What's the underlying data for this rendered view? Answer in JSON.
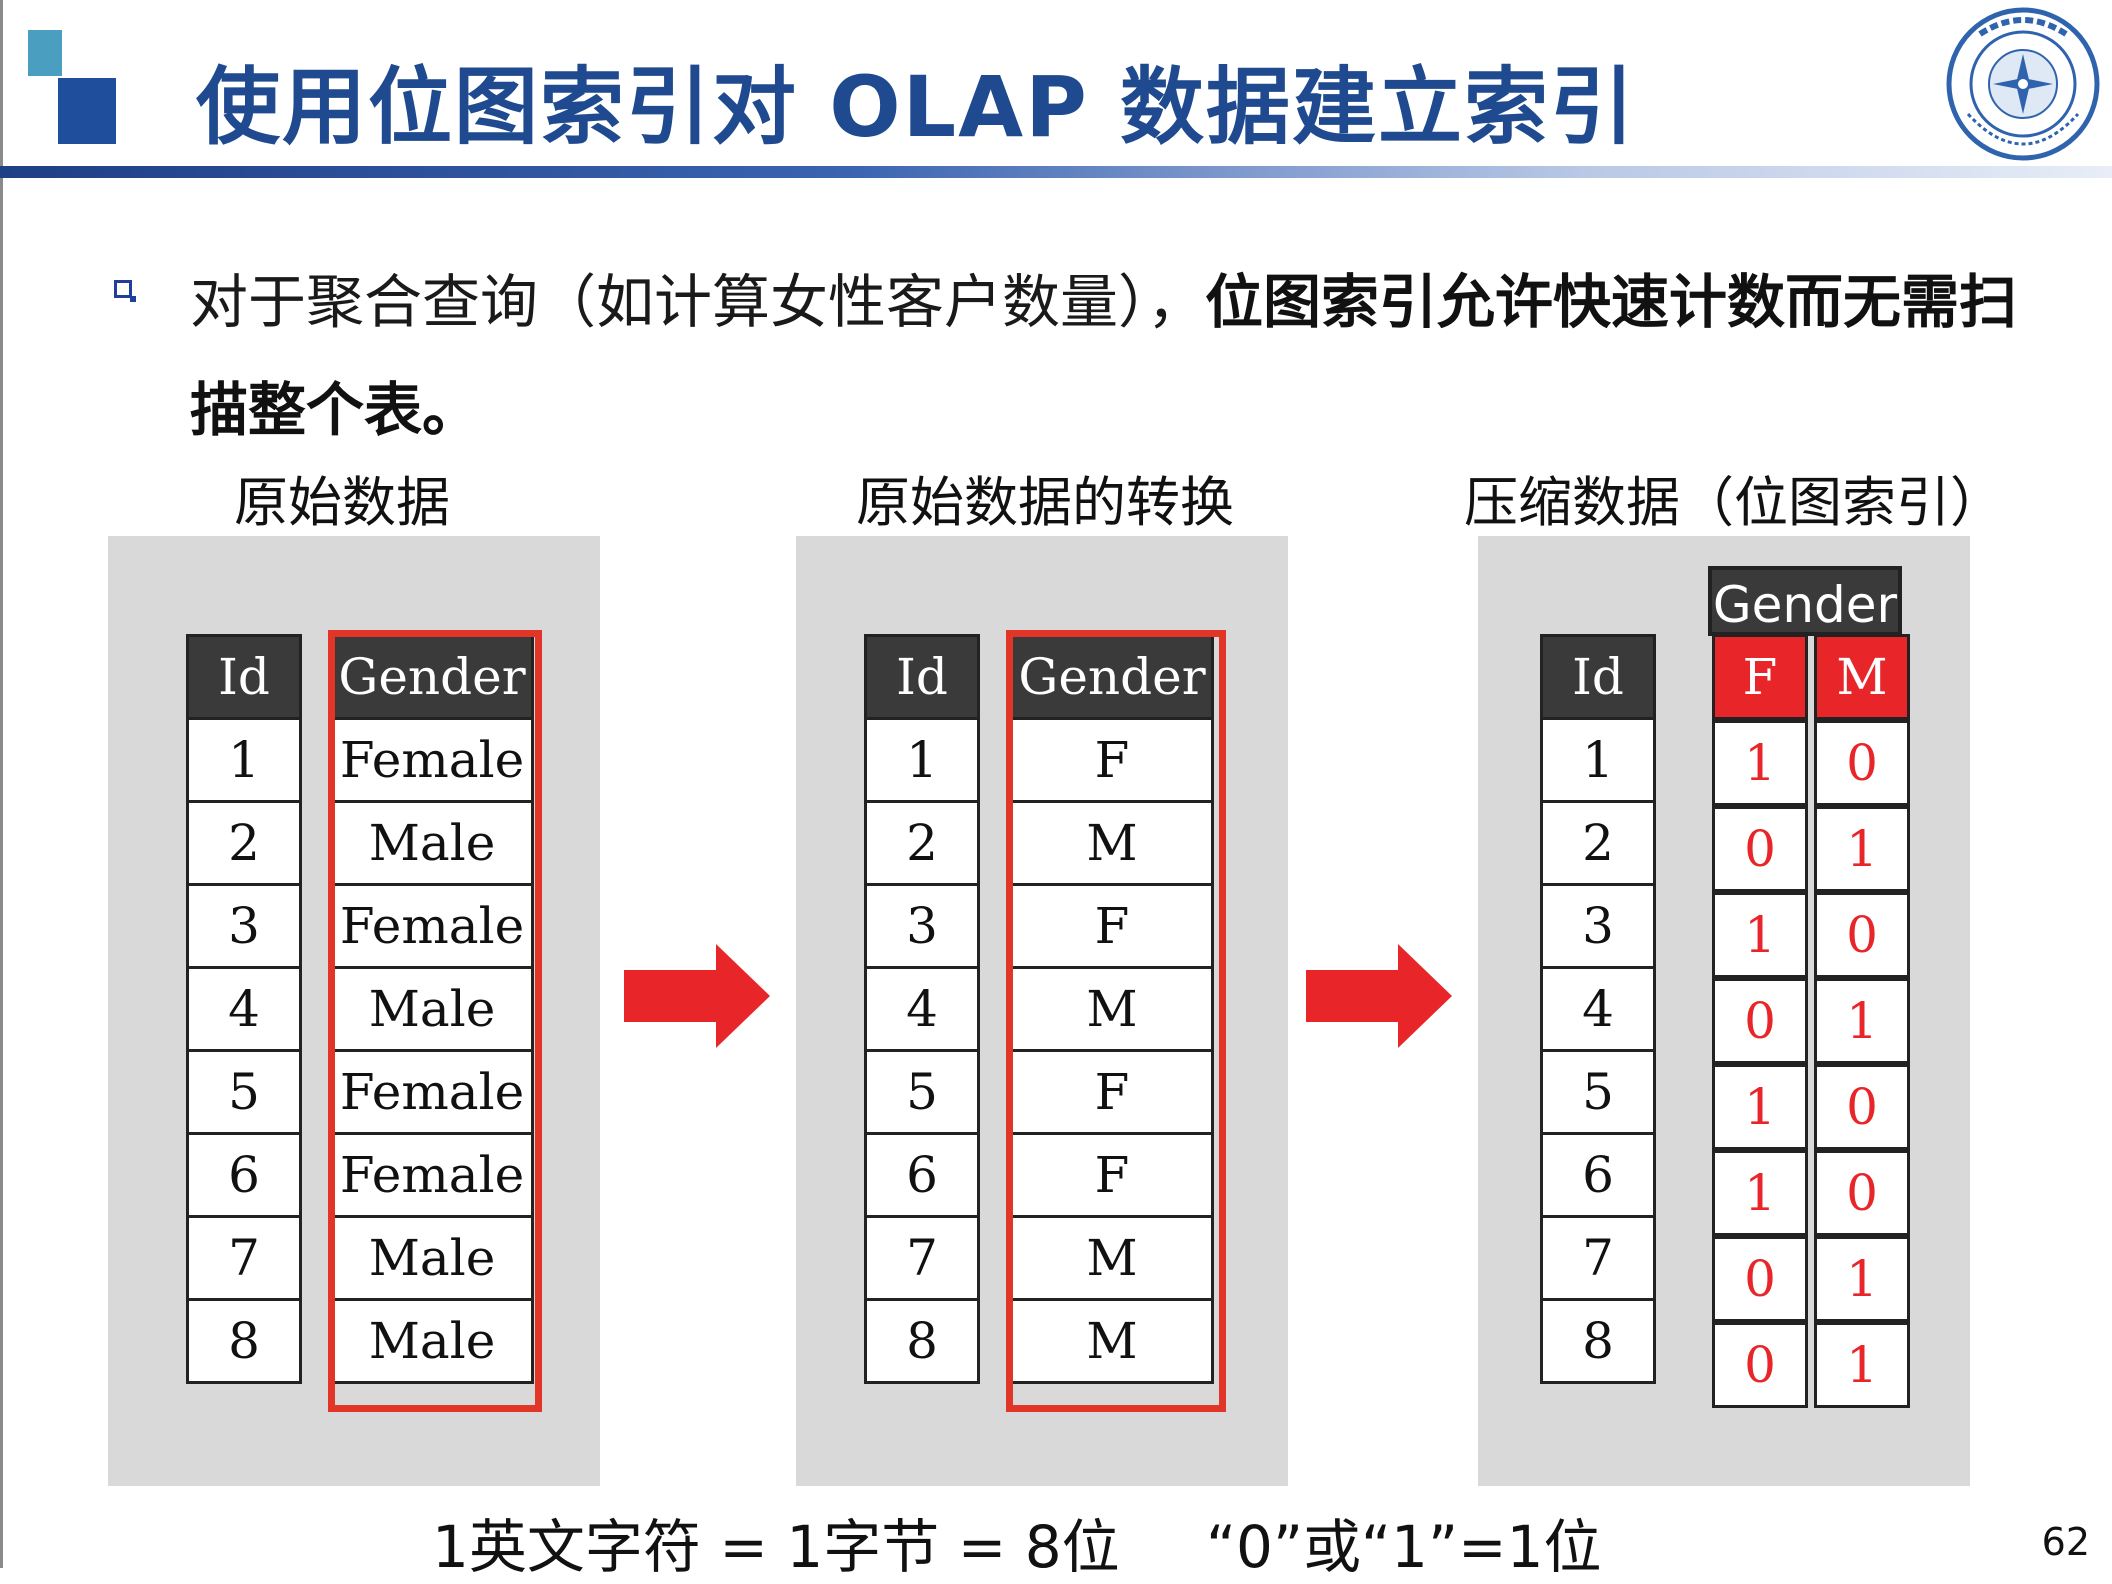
{
  "slide": {
    "title": "使用位图索引对 OLAP 数据建立索引",
    "bullet_normal": "对于聚合查询（如计算女性客户数量），",
    "bullet_bold": "位图索引允许快速计数而无需扫描整个表。",
    "page_number": "62"
  },
  "logo": {
    "name": "university-seal",
    "text": "中国地质大学 CHINA UNIVERSITY OF GEOSCIENCES 1952"
  },
  "panels": {
    "raw_title": "原始数据",
    "transformed_title": "原始数据的转换",
    "compressed_title": "压缩数据（位图索引）"
  },
  "headers": {
    "id": "Id",
    "gender": "Gender",
    "f": "F",
    "m": "M"
  },
  "raw_rows": [
    {
      "id": "1",
      "gender": "Female"
    },
    {
      "id": "2",
      "gender": "Male"
    },
    {
      "id": "3",
      "gender": "Female"
    },
    {
      "id": "4",
      "gender": "Male"
    },
    {
      "id": "5",
      "gender": "Female"
    },
    {
      "id": "6",
      "gender": "Female"
    },
    {
      "id": "7",
      "gender": "Male"
    },
    {
      "id": "8",
      "gender": "Male"
    }
  ],
  "transformed_rows": [
    {
      "id": "1",
      "gender": "F"
    },
    {
      "id": "2",
      "gender": "M"
    },
    {
      "id": "3",
      "gender": "F"
    },
    {
      "id": "4",
      "gender": "M"
    },
    {
      "id": "5",
      "gender": "F"
    },
    {
      "id": "6",
      "gender": "F"
    },
    {
      "id": "7",
      "gender": "M"
    },
    {
      "id": "8",
      "gender": "M"
    }
  ],
  "bitmap_rows": [
    {
      "id": "1",
      "f": "1",
      "m": "0"
    },
    {
      "id": "2",
      "f": "0",
      "m": "1"
    },
    {
      "id": "3",
      "f": "1",
      "m": "0"
    },
    {
      "id": "4",
      "f": "0",
      "m": "1"
    },
    {
      "id": "5",
      "f": "1",
      "m": "0"
    },
    {
      "id": "6",
      "f": "1",
      "m": "0"
    },
    {
      "id": "7",
      "f": "0",
      "m": "1"
    },
    {
      "id": "8",
      "f": "0",
      "m": "1"
    }
  ],
  "footnotes": {
    "left": "1英文字符 = 1字节 = 8位",
    "right": "“0”或“1”=1位"
  },
  "colors": {
    "accent_red": "#e8262a",
    "title_blue": "#1f4a8f",
    "header_dark": "#3a3a3a",
    "panel_gray": "#d9d9d9"
  }
}
